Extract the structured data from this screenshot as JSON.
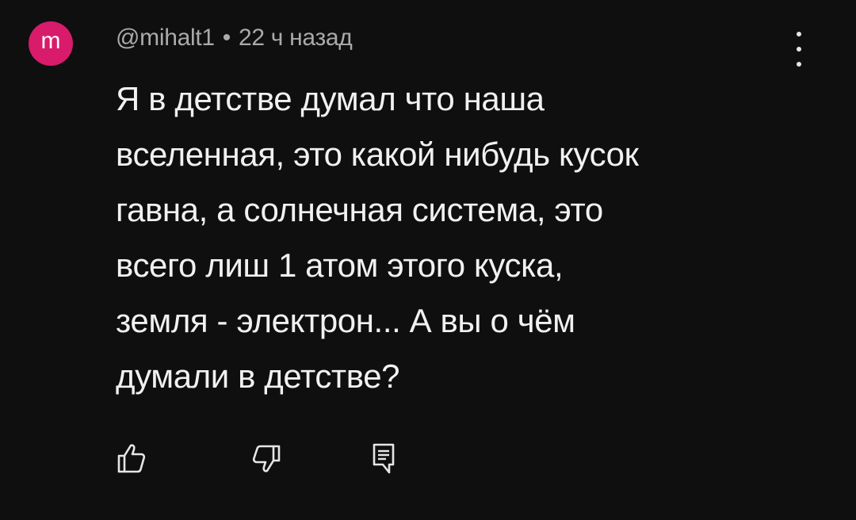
{
  "comment": {
    "avatar_letter": "m",
    "avatar_color": "#d81b6a",
    "author": "@mihalt1",
    "separator": "•",
    "time": "22 ч назад",
    "text_lines": [
      "Я в детстве думал что наша",
      "вселенная, это какой нибудь кусок",
      "гавна, а солнечная система, это",
      "всего лиш 1 атом этого куска,",
      "земля - электрон... А вы о чём",
      "думали в детстве?"
    ]
  },
  "icons": {
    "menu": "more-vert-icon",
    "like": "thumb-up-icon",
    "dislike": "thumb-down-icon",
    "reply": "reply-comment-icon"
  }
}
